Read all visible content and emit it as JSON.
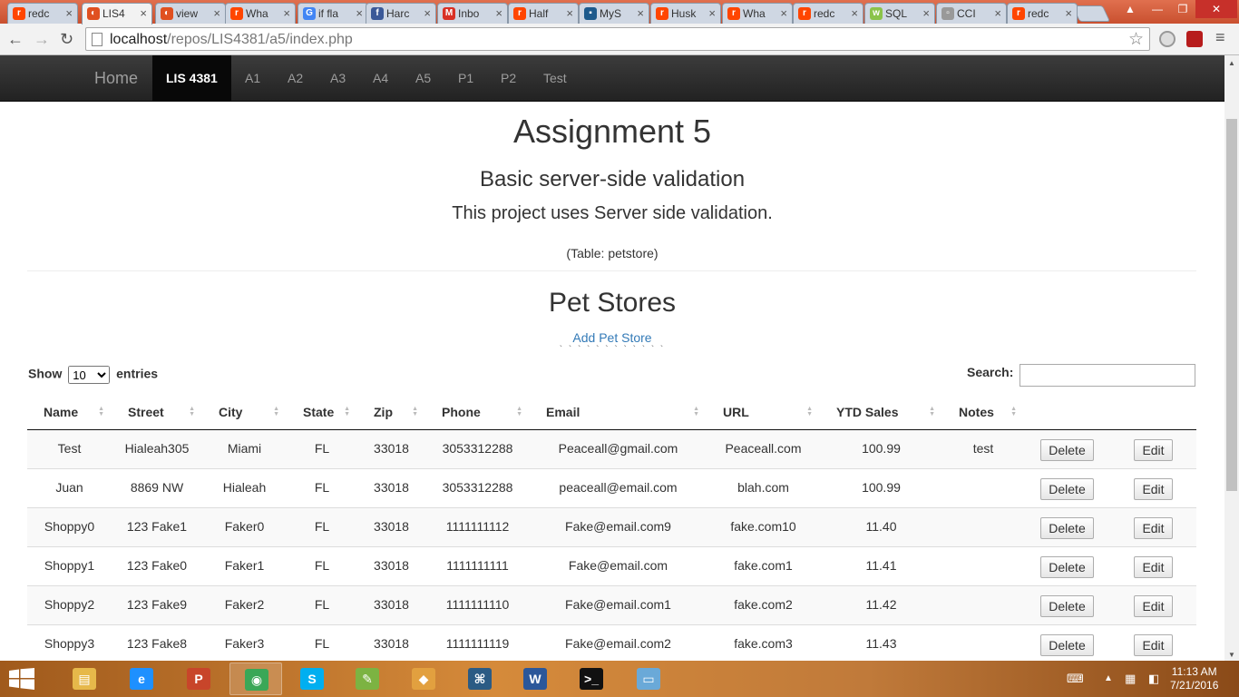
{
  "browser": {
    "tabs": [
      {
        "label": "redc",
        "color": "#ff4500",
        "glyph": "r"
      },
      {
        "label": "LIS4",
        "color": "#e05020",
        "glyph": "◐",
        "active": true
      },
      {
        "label": "view",
        "color": "#e05020",
        "glyph": "◐"
      },
      {
        "label": "Wha",
        "color": "#ff4500",
        "glyph": "r"
      },
      {
        "label": "if fla",
        "color": "#4285f4",
        "glyph": "G"
      },
      {
        "label": "Harc",
        "color": "#3b5998",
        "glyph": "f"
      },
      {
        "label": "Inbo",
        "color": "#d93025",
        "glyph": "M"
      },
      {
        "label": "Half",
        "color": "#ff4500",
        "glyph": "r"
      },
      {
        "label": "MyS",
        "color": "#1d5a8c",
        "glyph": "▪"
      },
      {
        "label": "Husk",
        "color": "#ff4500",
        "glyph": "r"
      },
      {
        "label": "Wha",
        "color": "#ff4500",
        "glyph": "r"
      },
      {
        "label": "redc",
        "color": "#ff4500",
        "glyph": "r"
      },
      {
        "label": "SQL",
        "color": "#8bc34a",
        "glyph": "w"
      },
      {
        "label": "CCI",
        "color": "#999999",
        "glyph": "▫"
      },
      {
        "label": "redc",
        "color": "#ff4500",
        "glyph": "r"
      }
    ],
    "url_host": "localhost",
    "url_path": "/repos/LIS4381/a5/index.php"
  },
  "navbar": {
    "brand": "Home",
    "links": [
      "LIS 4381",
      "A1",
      "A2",
      "A3",
      "A4",
      "A5",
      "P1",
      "P2",
      "Test"
    ],
    "active_index": 0
  },
  "header": {
    "title": "Assignment 5",
    "subtitle": "Basic server-side validation",
    "description": "This project uses Server side validation.",
    "table_name": "(Table: petstore)"
  },
  "section": {
    "title": "Pet Stores",
    "add_link": "Add Pet Store",
    "ticks": "` ` ` ` ` ` ` ` ` ` ` `"
  },
  "controls": {
    "show_prefix": "Show",
    "show_value": "10",
    "show_suffix": "entries",
    "search_label": "Search:"
  },
  "table": {
    "columns": [
      "Name",
      "Street",
      "City",
      "State",
      "Zip",
      "Phone",
      "Email",
      "URL",
      "YTD Sales",
      "Notes"
    ],
    "delete_label": "Delete",
    "edit_label": "Edit",
    "rows": [
      [
        "Test",
        "Hialeah305",
        "Miami",
        "FL",
        "33018",
        "3053312288",
        "Peaceall@gmail.com",
        "Peaceall.com",
        "100.99",
        "test"
      ],
      [
        "Juan",
        "8869 NW",
        "Hialeah",
        "FL",
        "33018",
        "3053312288",
        "peaceall@email.com",
        "blah.com",
        "100.99",
        ""
      ],
      [
        "Shoppy0",
        "123 Fake1",
        "Faker0",
        "FL",
        "33018",
        "1111111112",
        "Fake@email.com9",
        "fake.com10",
        "11.40",
        ""
      ],
      [
        "Shoppy1",
        "123 Fake0",
        "Faker1",
        "FL",
        "33018",
        "1111111111",
        "Fake@email.com",
        "fake.com1",
        "11.41",
        ""
      ],
      [
        "Shoppy2",
        "123 Fake9",
        "Faker2",
        "FL",
        "33018",
        "1111111110",
        "Fake@email.com1",
        "fake.com2",
        "11.42",
        ""
      ],
      [
        "Shoppy3",
        "123 Fake8",
        "Faker3",
        "FL",
        "33018",
        "1111111119",
        "Fake@email.com2",
        "fake.com3",
        "11.43",
        ""
      ]
    ]
  },
  "taskbar": {
    "apps": [
      {
        "name": "file-explorer-icon",
        "color": "#e6b84a",
        "glyph": "▤"
      },
      {
        "name": "internet-explorer-icon",
        "color": "#1e90ff",
        "glyph": "e"
      },
      {
        "name": "powerpoint-icon",
        "color": "#c8452a",
        "glyph": "P"
      },
      {
        "name": "chrome-icon",
        "color": "#3aa757",
        "glyph": "◉",
        "open": true
      },
      {
        "name": "skype-icon",
        "color": "#00aff0",
        "glyph": "S"
      },
      {
        "name": "notepad-plus-icon",
        "color": "#7cb342",
        "glyph": "✎"
      },
      {
        "name": "git-icon",
        "color": "#e2a03f",
        "glyph": "◆"
      },
      {
        "name": "mysql-workbench-icon",
        "color": "#2b5b84",
        "glyph": "⌘"
      },
      {
        "name": "word-icon",
        "color": "#2b579a",
        "glyph": "W"
      },
      {
        "name": "command-prompt-icon",
        "color": "#111111",
        "glyph": ">_"
      },
      {
        "name": "notepad-icon",
        "color": "#6aa9d8",
        "glyph": "▭"
      }
    ],
    "time": "11:13 AM",
    "date": "7/21/2016"
  }
}
